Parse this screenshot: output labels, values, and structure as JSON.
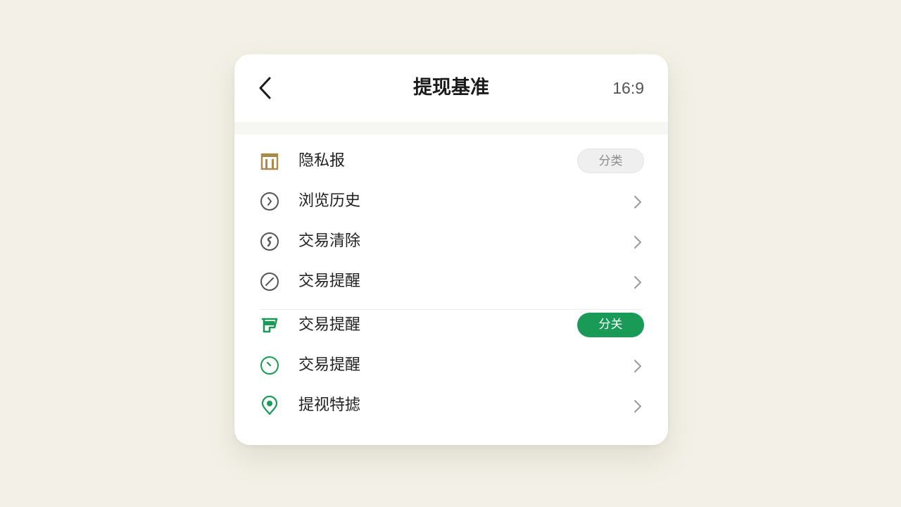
{
  "header": {
    "title": "提现基准",
    "ratio": "16:9"
  },
  "rows": [
    {
      "label": "隐私报",
      "icon": "building-icon",
      "trailing": "pill",
      "pill_text": "分类"
    },
    {
      "label": "浏览历史",
      "icon": "chevron-circle-icon",
      "trailing": "chevron"
    },
    {
      "label": "交易清除",
      "icon": "coin-circle-icon",
      "trailing": "chevron"
    },
    {
      "label": "交易提醒",
      "icon": "slash-circle-icon",
      "trailing": "chevron"
    },
    {
      "label": "交易提醒",
      "icon": "cup-icon",
      "trailing": "pill",
      "pill_text": "分关"
    },
    {
      "label": "交易提醒",
      "icon": "clock-icon",
      "trailing": "chevron"
    },
    {
      "label": "提视特摅",
      "icon": "location-pin-icon",
      "trailing": "chevron"
    }
  ],
  "colors": {
    "page_bg": "#f3f1e7",
    "card_bg": "#ffffff",
    "accent_green": "#1a9a57",
    "accent_gold": "#a88a4a",
    "icon_gray": "#555555"
  }
}
